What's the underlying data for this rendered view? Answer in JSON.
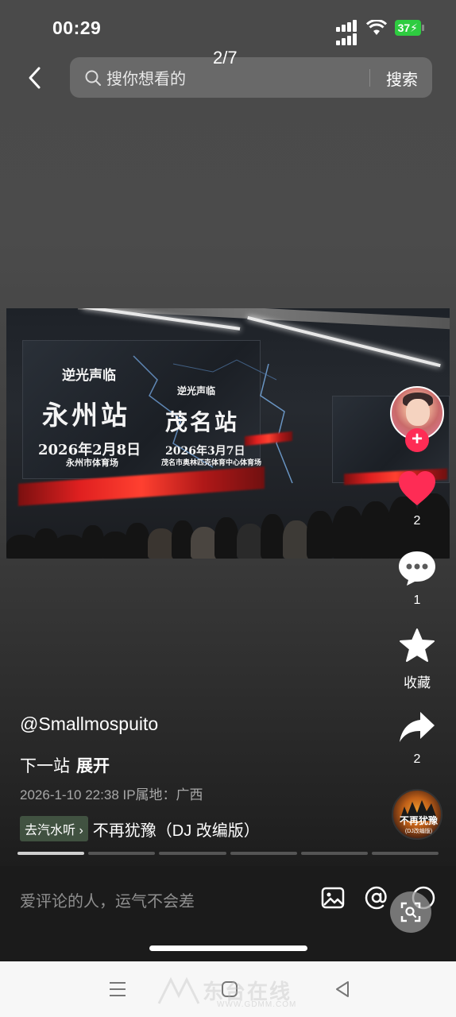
{
  "status_bar": {
    "time": "00:29",
    "battery": "37"
  },
  "top_bar": {
    "page_indicator": "2/7",
    "search_placeholder": "搜你想看的",
    "search_button": "搜索"
  },
  "photo": {
    "left_logo": "逆光声临",
    "left_city": "永州站",
    "left_date": "2026年2月8日",
    "left_venue": "永州市体育场",
    "right_logo": "逆光声临",
    "right_city": "茂名站",
    "right_date": "2026年3月7日",
    "right_venue": "茂名市奥林匹克体育中心体育场"
  },
  "actions": {
    "like_count": "2",
    "comment_count": "1",
    "favorite_label": "收藏",
    "share_count": "2"
  },
  "post": {
    "author": "@Smallmospuito",
    "description": "下一站",
    "expand": "展开",
    "meta": "2026-1-10 22:38  IP属地：广西",
    "music_tag": "去汽水听 ›",
    "music_name": "不再犹豫（DJ 改编版）",
    "disc_title": "不再犹豫",
    "disc_sub": "(DJ改编版)",
    "slides_total": 6,
    "slide_active": 1
  },
  "comment_bar": {
    "placeholder": "爱评论的人，运气不会差"
  },
  "watermark": {
    "text": "东台在线",
    "url": "WWW.GDMM.COM"
  },
  "colors": {
    "like": "#fe2c55",
    "music_tag": "#465a46",
    "battery": "#2ecc40"
  }
}
